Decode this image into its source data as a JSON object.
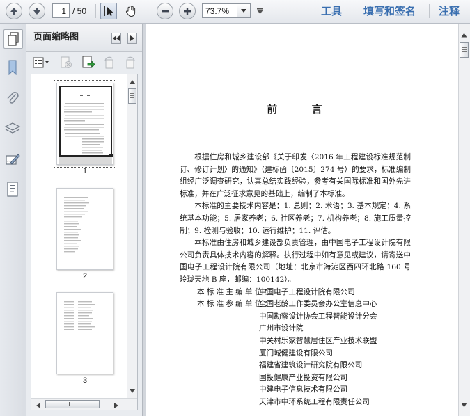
{
  "toolbar": {
    "page_current": "1",
    "page_total": "/ 50",
    "zoom": "73.7%",
    "tools_label": "工具",
    "sign_label": "填写和签名",
    "comment_label": "注释"
  },
  "left_strip": {
    "icons": [
      "bookmark-icon",
      "attachment-icon",
      "layers-icon",
      "signature-icon",
      "content-icon"
    ]
  },
  "thumbnail_panel": {
    "title": "页面缩略图",
    "thumbnails": [
      {
        "page": "1",
        "selected": true
      },
      {
        "page": "2",
        "selected": false
      },
      {
        "page": "3",
        "selected": false
      }
    ]
  },
  "document": {
    "title": "前  言",
    "para1": "根据住房和城乡建设部《关于印发〈2016 年工程建设标准规范制订、修订计划〉的通知》（建标函〔2015〕274 号）的要求，标准编制组经广泛调查研究，认真总结实践经验，参考有关国际标准和国外先进标准，并在广泛征求意见的基础上，编制了本标准。",
    "para2": "本标准的主要技术内容是：1. 总则；2. 术语；3. 基本规定；4. 系统基本功能；5. 居家养老；6. 社区养老；7. 机构养老；8. 施工质量控制；9. 检测与验收；10. 运行维护；11. 评估。",
    "para3": "本标准由住房和城乡建设部负责管理，由中国电子工程设计院有限公司负责具体技术内容的解释。执行过程中如有意见或建议，请寄送中国电子工程设计院有限公司（地址：北京市海淀区西四环北路 160 号玲珑天地 B 座，邮编：100142）。",
    "chief_label": "本标准主编单位：",
    "chief_unit": "中国电子工程设计院有限公司",
    "participant_label": "本标准参编单位：",
    "participants": [
      "全国老龄工作委员会办公室信息中心",
      "中国勘察设计协会工程智能设计分会",
      "广州市设计院",
      "中关村乐家智慧居住区产业技术联盟",
      "厦门城健建设有限公司",
      "福建省建筑设计研究院有限公司",
      "国投健康产业投资有限公司",
      "中建电子信息技术有限公司",
      "天津市中环系统工程有限责任公司"
    ]
  }
}
